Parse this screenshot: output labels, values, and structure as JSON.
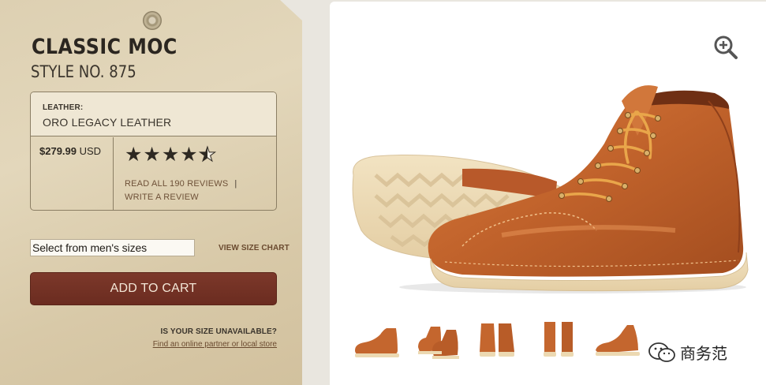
{
  "product": {
    "name": "CLASSIC MOC",
    "style_no": "STYLE NO. 875",
    "leather_label": "LEATHER:",
    "leather_value": "ORO LEGACY LEATHER",
    "price_amount": "$279.99",
    "price_currency": "USD",
    "rating": 4.5,
    "reviews_link": "READ ALL 190 REVIEWS",
    "reviews_sep": "|",
    "write_review_link": "WRITE A REVIEW"
  },
  "purchase": {
    "size_select_value": "Select from men's sizes",
    "size_chart_link": "VIEW SIZE CHART",
    "add_to_cart_label": "ADD TO CART",
    "unavailable_question": "IS YOUR SIZE UNAVAILABLE?",
    "partner_link": "Find an online partner or local store"
  },
  "gallery": {
    "zoom_icon": "zoom-in-icon",
    "thumbnails": [
      "side-view",
      "angle-pair",
      "front-pair",
      "back-pair",
      "side-angle"
    ],
    "watermark_text": "商务范",
    "watermark_icon": "wechat-icon"
  },
  "colors": {
    "tag_background": "#ddd0b2",
    "cart_button": "#7c382a",
    "boot_leather": "#c56a32",
    "link_brown": "#6a4a2f"
  }
}
